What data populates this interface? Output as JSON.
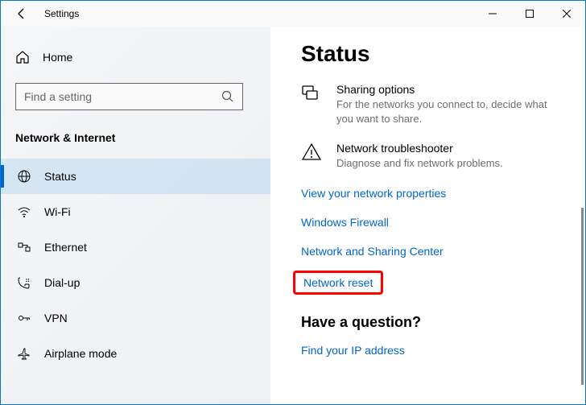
{
  "titlebar": {
    "title": "Settings"
  },
  "sidebar": {
    "home_label": "Home",
    "search_placeholder": "Find a setting",
    "category": "Network & Internet",
    "items": [
      {
        "label": "Status",
        "active": true
      },
      {
        "label": "Wi-Fi",
        "active": false
      },
      {
        "label": "Ethernet",
        "active": false
      },
      {
        "label": "Dial-up",
        "active": false
      },
      {
        "label": "VPN",
        "active": false
      },
      {
        "label": "Airplane mode",
        "active": false
      }
    ]
  },
  "main": {
    "heading": "Status",
    "options": [
      {
        "title": "Sharing options",
        "desc": "For the networks you connect to, decide what you want to share."
      },
      {
        "title": "Network troubleshooter",
        "desc": "Diagnose and fix network problems."
      }
    ],
    "links": [
      "View your network properties",
      "Windows Firewall",
      "Network and Sharing Center",
      "Network reset"
    ],
    "question_heading": "Have a question?",
    "question_links": [
      "Find your IP address"
    ]
  }
}
